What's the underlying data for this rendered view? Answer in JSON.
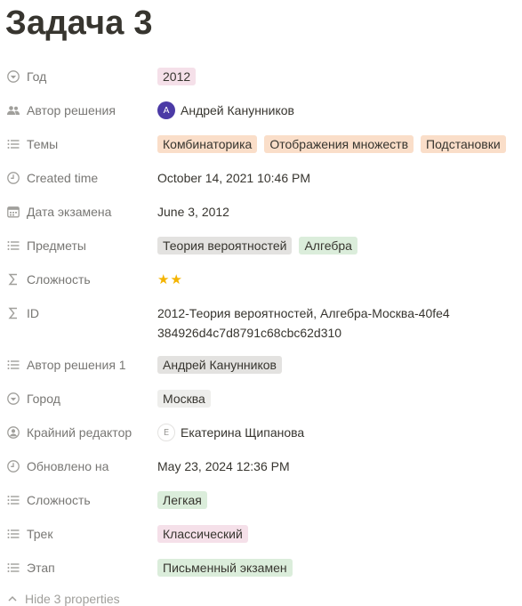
{
  "page": {
    "title": "Задача 3"
  },
  "properties": [
    {
      "id": "year",
      "name": "Год",
      "icon": "select-icon",
      "type": "tags",
      "tags": [
        {
          "label": "2012",
          "color": "pink"
        }
      ]
    },
    {
      "id": "author",
      "name": "Автор решения",
      "icon": "people-icon",
      "type": "person",
      "person": {
        "initial": "А",
        "name": "Андрей Канунников"
      }
    },
    {
      "id": "topics",
      "name": "Темы",
      "icon": "list-icon",
      "type": "tags",
      "tags": [
        {
          "label": "Комбинаторика",
          "color": "orange"
        },
        {
          "label": "Отображения множеств",
          "color": "orange"
        },
        {
          "label": "Подстановки",
          "color": "orange"
        }
      ]
    },
    {
      "id": "created",
      "name": "Created time",
      "icon": "clock-icon",
      "type": "text",
      "text": "October 14, 2021 10:46 PM"
    },
    {
      "id": "exam_date",
      "name": "Дата экзамена",
      "icon": "calendar-icon",
      "type": "text",
      "text": "June 3, 2012"
    },
    {
      "id": "subjects",
      "name": "Предметы",
      "icon": "list-icon",
      "type": "tags",
      "tags": [
        {
          "label": "Теория вероятностей",
          "color": "gray"
        },
        {
          "label": "Алгебра",
          "color": "green"
        }
      ]
    },
    {
      "id": "difficulty_formula",
      "name": "Сложность",
      "icon": "sigma-icon",
      "type": "stars",
      "text": "★★",
      "rating": 2
    },
    {
      "id": "formula_id",
      "name": "ID",
      "icon": "sigma-icon",
      "type": "id",
      "text": "2012-Теория вероятностей, Алгебра-Москва-40fe4384926d4c7d8791c68cbc62d310"
    },
    {
      "id": "author1",
      "name": "Автор решения 1",
      "icon": "list-icon",
      "type": "tags",
      "tags": [
        {
          "label": "Андрей Канунников",
          "color": "gray"
        }
      ]
    },
    {
      "id": "city",
      "name": "Город",
      "icon": "select-icon",
      "type": "tags",
      "tags": [
        {
          "label": "Москва",
          "color": "beige"
        }
      ]
    },
    {
      "id": "editor",
      "name": "Крайний редактор",
      "icon": "person-circle-icon",
      "type": "person-outline",
      "person": {
        "initial": "Е",
        "name": "Екатерина Щипанова"
      }
    },
    {
      "id": "updated",
      "name": "Обновлено на",
      "icon": "clock-icon",
      "type": "text",
      "text": "May 23, 2024 12:36 PM"
    },
    {
      "id": "difficulty",
      "name": "Сложность",
      "icon": "list-icon",
      "type": "tags",
      "tags": [
        {
          "label": "Легкая",
          "color": "green"
        }
      ]
    },
    {
      "id": "track",
      "name": "Трек",
      "icon": "list-icon",
      "type": "tags",
      "tags": [
        {
          "label": "Классический",
          "color": "pink"
        }
      ]
    },
    {
      "id": "stage",
      "name": "Этап",
      "icon": "list-icon",
      "type": "tags",
      "tags": [
        {
          "label": "Письменный экзамен",
          "color": "green"
        }
      ]
    }
  ],
  "footer": {
    "hide_label": "Hide 3 properties",
    "icon": "chevron-up-icon"
  },
  "colors": {
    "text": "#37352f",
    "muted": "#787774",
    "star": "#f4b400",
    "avatar": "#4b3aa6"
  }
}
